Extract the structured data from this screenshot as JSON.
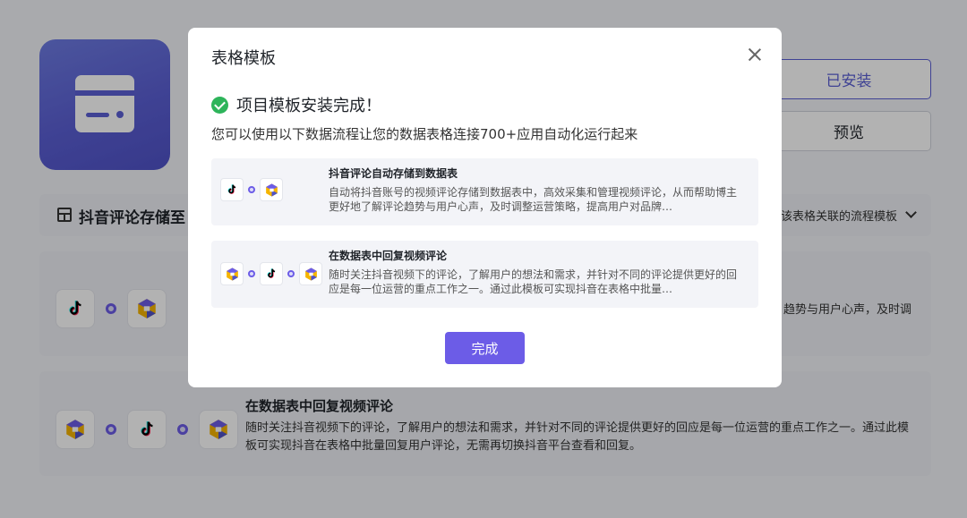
{
  "colors": {
    "accent": "#6c5ce7",
    "success": "#2db45a",
    "icon_gradient_start": "#6d7be2",
    "icon_gradient_end": "#4f52c7"
  },
  "background": {
    "installed_label": "已安装",
    "preview_label": "预览",
    "flow_section": {
      "title": "抖音评论存储至",
      "right_text": "该表格关联的流程模板"
    },
    "cards": [
      {
        "tail_text": "趋势与用户心声，及时调",
        "icons": [
          "tiktok-icon",
          "app-logo-icon"
        ]
      },
      {
        "title": "在数据表中回复视频评论",
        "description": "随时关注抖音视频下的评论，了解用户的想法和需求，并针对不同的评论提供更好的回应是每一位运营的重点工作之一。通过此模板可实现抖音在表格中批量回复用户评论，无需再切换抖音平台查看和回复。",
        "icons": [
          "app-logo-icon",
          "tiktok-icon",
          "app-logo-icon"
        ]
      }
    ]
  },
  "modal": {
    "title": "表格模板",
    "success_message": "项目模板安装完成！",
    "subtitle": "您可以使用以下数据流程让您的数据表格连接700+应用自动化运行起来",
    "templates": [
      {
        "title": "抖音评论自动存储到数据表",
        "description": "自动将抖音账号的视频评论存储到数据表中，高效采集和管理视频评论，从而帮助博主更好地了解评论趋势与用户心声，及时调整运营策略，提高用户对品牌…",
        "icons": [
          "tiktok-icon",
          "app-logo-icon"
        ]
      },
      {
        "title": "在数据表中回复视频评论",
        "description": "随时关注抖音视频下的评论，了解用户的想法和需求，并针对不同的评论提供更好的回应是每一位运营的重点工作之一。通过此模板可实现抖音在表格中批量…",
        "icons": [
          "app-logo-icon",
          "tiktok-icon",
          "app-logo-icon"
        ]
      }
    ],
    "done_label": "完成"
  }
}
